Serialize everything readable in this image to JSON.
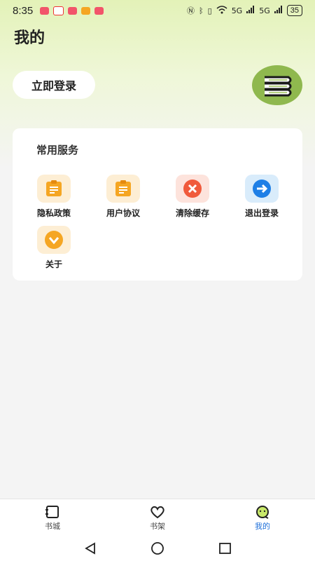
{
  "status_bar": {
    "time": "8:35",
    "network_label": "5G",
    "battery": "35"
  },
  "header": {
    "title": "我的",
    "login_label": "立即登录"
  },
  "services": {
    "title": "常用服务",
    "items": [
      {
        "label": "隐私政策",
        "icon": "clipboard-icon",
        "color": "#f5a623"
      },
      {
        "label": "用户协议",
        "icon": "clipboard-icon",
        "color": "#f5a623"
      },
      {
        "label": "清除缓存",
        "icon": "close-circle-icon",
        "color": "#f05a3c"
      },
      {
        "label": "退出登录",
        "icon": "arrow-right-circle-icon",
        "color": "#1e7fe6"
      },
      {
        "label": "关于",
        "icon": "chevron-down-circle-icon",
        "color": "#f5a623"
      }
    ]
  },
  "tabbar": {
    "items": [
      {
        "label": "书城",
        "icon": "book-icon",
        "active": false
      },
      {
        "label": "书架",
        "icon": "heart-icon",
        "active": false
      },
      {
        "label": "我的",
        "icon": "smile-face-icon",
        "active": true
      }
    ]
  },
  "colors": {
    "accent": "#1e6fd9",
    "avatar_bg": "#8fb84e",
    "header_gradient": "#e3f2b8"
  }
}
